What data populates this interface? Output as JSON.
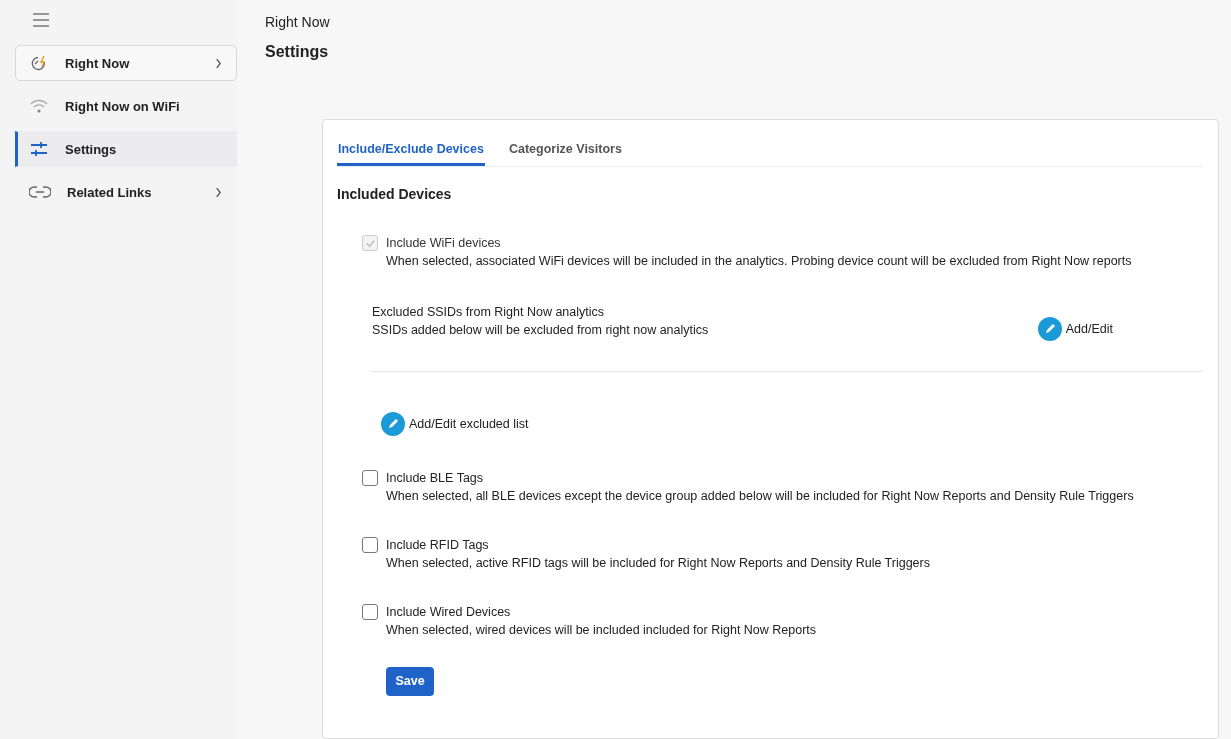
{
  "sidebar": {
    "items": [
      {
        "label": "Right Now",
        "outlined": true,
        "expandable": true,
        "selected": false
      },
      {
        "label": "Right Now on WiFi",
        "outlined": false,
        "expandable": false,
        "selected": false
      },
      {
        "label": "Settings",
        "outlined": false,
        "expandable": false,
        "selected": true
      },
      {
        "label": "Related Links",
        "outlined": false,
        "expandable": true,
        "selected": false
      }
    ]
  },
  "header": {
    "breadcrumb": "Right Now",
    "title": "Settings"
  },
  "tabs": [
    {
      "label": "Include/Exclude Devices",
      "selected": true
    },
    {
      "label": "Categorize Visitors",
      "selected": false
    }
  ],
  "section_title": "Included Devices",
  "options": [
    {
      "label": "Include WiFi devices",
      "description": "When selected, associated WiFi devices will be included in the analytics. Probing device count will be excluded from Right Now reports",
      "checked": true,
      "disabled": true,
      "exclusions": {
        "title": "Excluded SSIDs from Right Now analytics",
        "subtitle": "SSIDs added below will be excluded from right now analytics",
        "edit_button": "Add/Edit",
        "list_button": "Add/Edit excluded list"
      }
    },
    {
      "label": "Include BLE Tags",
      "description": "When selected, all BLE devices except the device group added below will be included for Right Now Reports and Density Rule Triggers",
      "checked": false,
      "disabled": false
    },
    {
      "label": "Include RFID Tags",
      "description": "When selected, active RFID tags will be included for Right Now Reports and Density Rule Triggers",
      "checked": false,
      "disabled": false
    },
    {
      "label": "Include Wired Devices",
      "description": "When selected, wired devices will be included included for Right Now Reports",
      "checked": false,
      "disabled": false
    }
  ],
  "save_button": "Save"
}
